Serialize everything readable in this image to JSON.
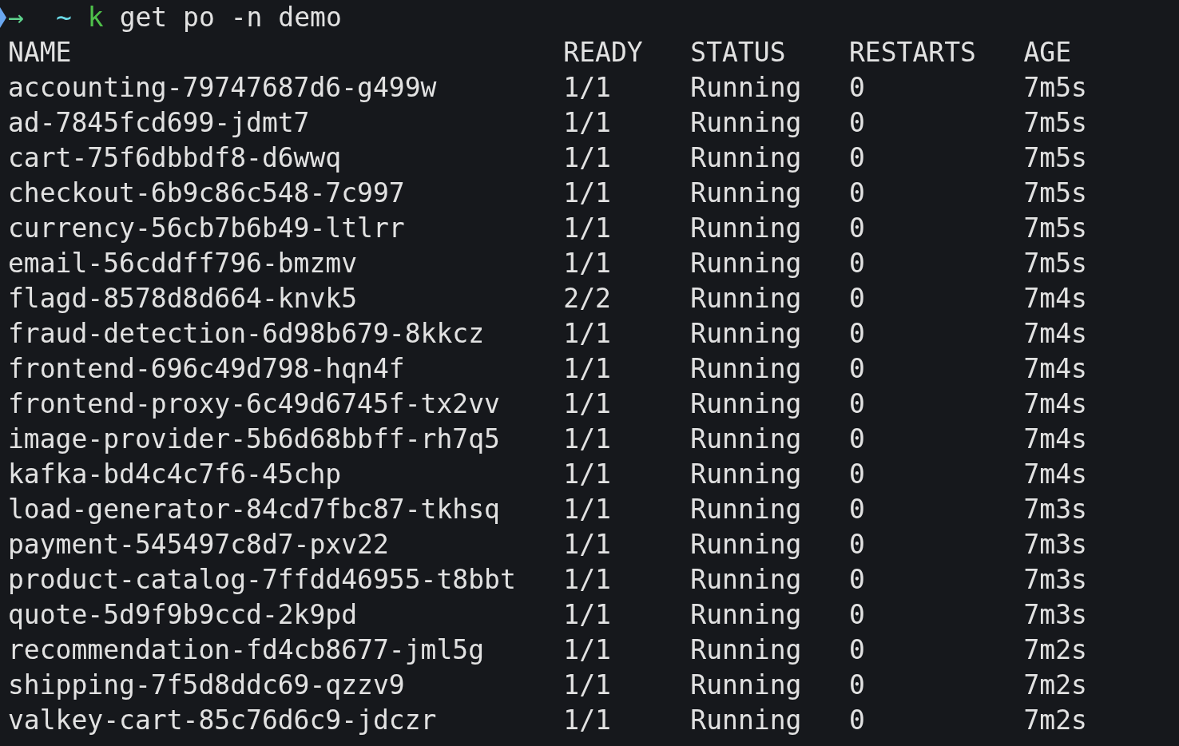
{
  "prompt": {
    "arrow": "→",
    "cwd": "~",
    "command": "k",
    "args": "get po -n demo"
  },
  "table": {
    "columns": [
      "NAME",
      "READY",
      "STATUS",
      "RESTARTS",
      "AGE"
    ],
    "rows": [
      [
        "accounting-79747687d6-g499w",
        "1/1",
        "Running",
        "0",
        "7m5s"
      ],
      [
        "ad-7845fcd699-jdmt7",
        "1/1",
        "Running",
        "0",
        "7m5s"
      ],
      [
        "cart-75f6dbbdf8-d6wwq",
        "1/1",
        "Running",
        "0",
        "7m5s"
      ],
      [
        "checkout-6b9c86c548-7c997",
        "1/1",
        "Running",
        "0",
        "7m5s"
      ],
      [
        "currency-56cb7b6b49-ltlrr",
        "1/1",
        "Running",
        "0",
        "7m5s"
      ],
      [
        "email-56cddff796-bmzmv",
        "1/1",
        "Running",
        "0",
        "7m5s"
      ],
      [
        "flagd-8578d8d664-knvk5",
        "2/2",
        "Running",
        "0",
        "7m4s"
      ],
      [
        "fraud-detection-6d98b679-8kkcz",
        "1/1",
        "Running",
        "0",
        "7m4s"
      ],
      [
        "frontend-696c49d798-hqn4f",
        "1/1",
        "Running",
        "0",
        "7m4s"
      ],
      [
        "frontend-proxy-6c49d6745f-tx2vv",
        "1/1",
        "Running",
        "0",
        "7m4s"
      ],
      [
        "image-provider-5b6d68bbff-rh7q5",
        "1/1",
        "Running",
        "0",
        "7m4s"
      ],
      [
        "kafka-bd4c4c7f6-45chp",
        "1/1",
        "Running",
        "0",
        "7m4s"
      ],
      [
        "load-generator-84cd7fbc87-tkhsq",
        "1/1",
        "Running",
        "0",
        "7m3s"
      ],
      [
        "payment-545497c8d7-pxv22",
        "1/1",
        "Running",
        "0",
        "7m3s"
      ],
      [
        "product-catalog-7ffdd46955-t8bbt",
        "1/1",
        "Running",
        "0",
        "7m3s"
      ],
      [
        "quote-5d9f9b9ccd-2k9pd",
        "1/1",
        "Running",
        "0",
        "7m3s"
      ],
      [
        "recommendation-fd4cb8677-jml5g",
        "1/1",
        "Running",
        "0",
        "7m2s"
      ],
      [
        "shipping-7f5d8ddc69-qzzv9",
        "1/1",
        "Running",
        "0",
        "7m2s"
      ],
      [
        "valkey-cart-85c76d6c9-jdczr",
        "1/1",
        "Running",
        "0",
        "7m2s"
      ]
    ]
  }
}
